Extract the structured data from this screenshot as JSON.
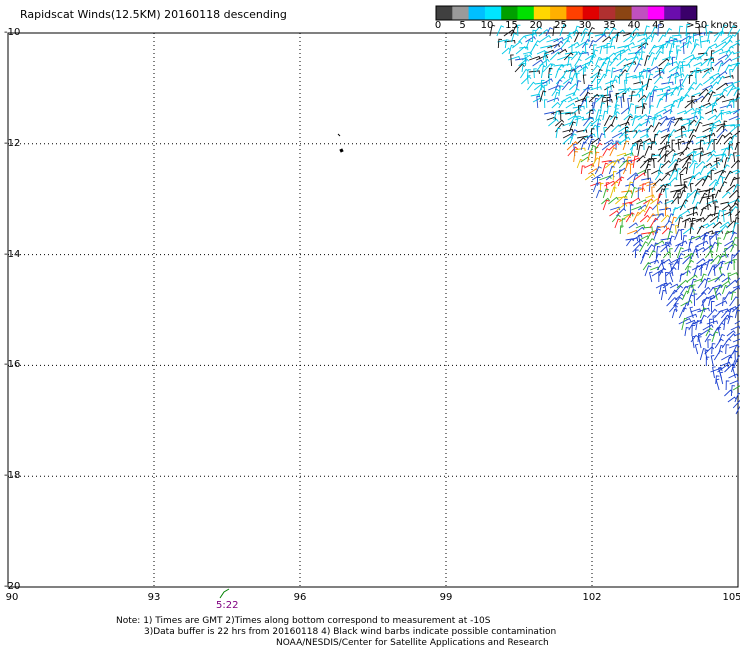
{
  "title": "Rapidscat Winds(12.5KM) 20160118 descending",
  "legend": {
    "labels": [
      "0",
      "5",
      "10",
      "15",
      "20",
      "25",
      "30",
      "35",
      "40",
      "45",
      ">50 knots"
    ],
    "colors": [
      "#404040",
      "#9a9a9a",
      "#00bfff",
      "#00e5ff",
      "#00a000",
      "#00e000",
      "#ffd700",
      "#ffb000",
      "#ff4000",
      "#e00000",
      "#b03030",
      "#8b4513",
      "#c050c0",
      "#ff00ff",
      "#6a0dad",
      "#3a006a"
    ]
  },
  "axes": {
    "lat_labels": [
      "-10",
      "-12",
      "-14",
      "-16",
      "-18",
      "-20"
    ],
    "lon_labels": [
      "90",
      "93",
      "96",
      "99",
      "102",
      "105"
    ],
    "lat_range": [
      -20,
      -10
    ],
    "lon_range": [
      90,
      105
    ]
  },
  "pass_time": "5:22",
  "notes": {
    "line1": "Note: 1) Times are GMT 2)Times along bottom correspond to measurement at -10S",
    "line2": "3)Data buffer is 22 hrs from 20160118 4) Black wind barbs indicate possible contamination",
    "line3": "NOAA/NESDIS/Center for Satellite Applications and Research"
  }
}
